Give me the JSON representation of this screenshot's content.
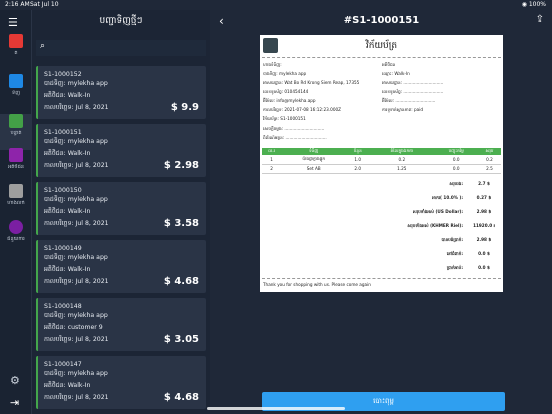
{
  "status": {
    "time": "2:16 AM",
    "date": "Sat Jul 10",
    "battery": "◉ 100%"
  },
  "nav": [
    {
      "label": "ត",
      "icon": "pos-icon",
      "color": "#e53935"
    },
    {
      "label": "ទិញ",
      "icon": "basket-icon",
      "color": "#1e88e5"
    },
    {
      "label": "បន្ទាត់",
      "icon": "list-icon",
      "color": "#43a047"
    },
    {
      "label": "អតិថិជន",
      "icon": "user-icon",
      "color": "#8e24aa"
    },
    {
      "label": "ហាងលក់",
      "icon": "store-icon",
      "color": "#9e9e9e"
    },
    {
      "label": "ជំនួយការ",
      "icon": "help-icon",
      "color": "#7b1fa2"
    }
  ],
  "list_title": "បញ្ជាទិញថ្មីៗ",
  "search": {
    "placeholder": ""
  },
  "orders": [
    {
      "id": "S1-1000152",
      "seller": "បាដទិញ: mylekha app",
      "customer": "អតិថិជន: Walk-In",
      "date": "កាលបរិច្ឆេទ: Jul 8, 2021",
      "amount": "$ 9.9"
    },
    {
      "id": "S1-1000151",
      "seller": "បាដទិញ: mylekha app",
      "customer": "អតិថិជន: Walk-In",
      "date": "កាលបរិច្ឆេទ: Jul 8, 2021",
      "amount": "$ 2.98"
    },
    {
      "id": "S1-1000150",
      "seller": "បាដទិញ: mylekha app",
      "customer": "អតិថិជន: Walk-In",
      "date": "កាលបរិច្ឆេទ: Jul 8, 2021",
      "amount": "$ 3.58"
    },
    {
      "id": "S1-1000149",
      "seller": "បាដទិញ: mylekha app",
      "customer": "អតិថិជន: Walk-In",
      "date": "កាលបរិច្ឆេទ: Jul 8, 2021",
      "amount": "$ 4.68"
    },
    {
      "id": "S1-1000148",
      "seller": "បាដទិញ: mylekha app",
      "customer": "អតិថិជន: customer 9",
      "date": "កាលបរិច្ឆេទ: Jul 8, 2021",
      "amount": "$ 3.05"
    },
    {
      "id": "S1-1000147",
      "seller": "បាដទិញ: mylekha app",
      "customer": "អតិថិជន: Walk-In",
      "date": "កាលបរិច្ឆេទ: Jul 8, 2021",
      "amount": "$ 4.68"
    }
  ],
  "detail": {
    "title": "#S1-1000151",
    "receipt_title": "វិក័យប័ត្រ",
    "left_rows": [
      "ហាងទំនិញ:",
      "បាងទិញ: mylekha app",
      "អាសយដ្ឋាន: Wat Bo Rd Krong Siem Reap, 17355",
      "លេខទូរស័ព្ទ: 010454144",
      "អ៊ីម៉ែល: info@mylekha.app",
      "កាលបរិច្ឆេទ: 2021-07-08 16:12:23.000Z",
      "វិក័យប័ត្រ: S1-1000151",
      "សេចក្ដីចម្លង: ..............................",
      "ពិព័រណ៍អត្ថន: ..............................."
    ],
    "right_rows": [
      "អតិថិជន",
      "ឈ្មោះ: Walk-In",
      "អាសយដ្ឋាន: ..............................",
      "លេខទូរស័ព្ទ: ..............................",
      "អ៊ីម៉ែល: ..............................",
      "ការទូទាត់ស្ថានភាព: paid"
    ],
    "table_headers": [
      "ល.រ",
      "ទំនិញ",
      "ចំនួន",
      "តំលៃក្នុងឯកតា",
      "បញ្ចុះតម្លៃ",
      "សរុប"
    ],
    "items": [
      [
        "1",
        "ប៉ាងផ្លាក្លាងផ្លូក",
        "1.0",
        "0.2",
        "0.0",
        "0.2"
      ],
      [
        "2",
        "Set AB",
        "2.0",
        "1.25",
        "0.0",
        "2.5"
      ]
    ],
    "summary": [
      {
        "label": "សរុបរង:",
        "value": "2.7 $"
      },
      {
        "label": "អាករ( 10.0% ):",
        "value": "0.27 $"
      },
      {
        "label": "សរុបទាំងអស់ (US Dollar):",
        "value": "2.98 $"
      },
      {
        "label": "សរុបទាំងអស់ (KHMER Riel):",
        "value": "11920.0 ៛"
      },
      {
        "label": "បានបង់ប្រាក់:",
        "value": "2.98 $"
      },
      {
        "label": "នៅជំពាក់:",
        "value": "0.0 $"
      },
      {
        "label": "ប្រាក់អាប់:",
        "value": "0.0 $"
      }
    ],
    "footer": "Thank you for shopping with us. Please come again",
    "print_label": "បោះពុម្ព"
  }
}
